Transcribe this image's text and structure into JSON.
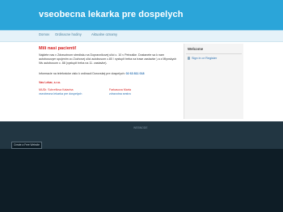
{
  "site": {
    "title": "vseobecna lekarka pre dospelych"
  },
  "nav": {
    "items": [
      "Domov",
      "Ordinacne hodiny",
      "Aktualne oznamy"
    ]
  },
  "main": {
    "heading": "Mili nasi pacienti!",
    "paragraph": "Najdete nas v Zdravotnom stredisku na Dopravnikovej ulici c. 10 v Petrzalke. Dostanete sa k nam autobusovym spojenim zo Zochovej ulici autobusom c.80 / vystupit treba na trase zastavke ) a z Mlynskych Niv autobusom c. 88 (vystupit treba na 11. zastavke).",
    "info_text": "Informacie na telefonicke cislo k ordinacii Dorovskej pre dospelych: 02 63 811 018",
    "info_label": "Informacie na telefonicke cislo k ordinacii Dorovskej pre dospelych:",
    "phone": "02 63 811 018",
    "team_title": "Vas Lekar, s.r.o.",
    "doctors": [
      {
        "name": "MUDr. Schreflova Katarina",
        "role": "vseobecna lekarka pre dospelych"
      },
      {
        "name": "Farkasova Marta",
        "role": "zdravotna sestra"
      }
    ]
  },
  "sidebar": {
    "title": "Welcome",
    "signin_label": "Sign in or Register"
  },
  "footer": {
    "logo_text": "WEBNODE",
    "create_badge": "Create a Free Website"
  },
  "colors": {
    "header_blue": "#2ba5d9",
    "heading_red": "#d51c1c",
    "link_blue": "#2a6fb0",
    "footer_dark": "#0e1d26"
  }
}
